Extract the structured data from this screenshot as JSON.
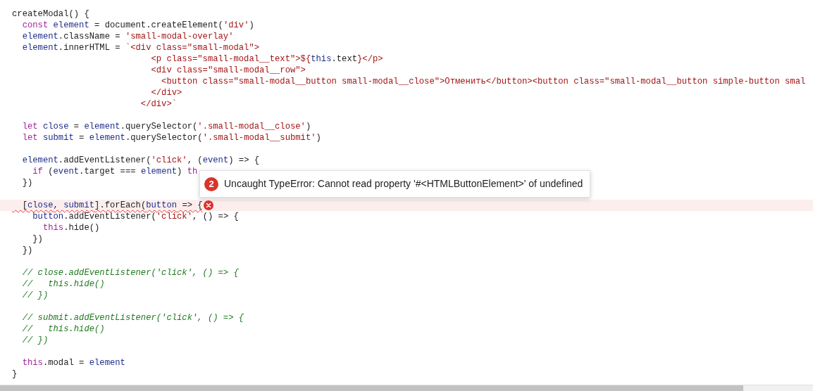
{
  "editor": {
    "lines": [
      {
        "kind": "code",
        "error": false,
        "tokens": [
          {
            "kind": "plain",
            "text": "createModal() {"
          }
        ]
      },
      {
        "kind": "code",
        "error": false,
        "tokens": [
          {
            "kind": "keyword",
            "text": "  const"
          },
          {
            "kind": "identifier",
            "text": " element"
          },
          {
            "kind": "plain",
            "text": " = document.createElement("
          },
          {
            "kind": "string",
            "text": "'div'"
          },
          {
            "kind": "plain",
            "text": ")"
          }
        ]
      },
      {
        "kind": "code",
        "error": false,
        "tokens": [
          {
            "kind": "identifier",
            "text": "  element"
          },
          {
            "kind": "plain",
            "text": ".className = "
          },
          {
            "kind": "string",
            "text": "'small-modal-overlay'"
          }
        ]
      },
      {
        "kind": "code",
        "error": false,
        "tokens": [
          {
            "kind": "identifier",
            "text": "  element"
          },
          {
            "kind": "plain",
            "text": ".innerHTML = "
          },
          {
            "kind": "string",
            "text": "`<div class=\"small-modal\">"
          }
        ]
      },
      {
        "kind": "code",
        "error": false,
        "tokens": [
          {
            "kind": "string",
            "text": "                           <p class=\"small-modal__text\">${"
          },
          {
            "kind": "identifier",
            "text": "this"
          },
          {
            "kind": "plain",
            "text": ".text"
          },
          {
            "kind": "string",
            "text": "}</p>"
          }
        ]
      },
      {
        "kind": "code",
        "error": false,
        "tokens": [
          {
            "kind": "string",
            "text": "                           <div class=\"small-modal__row\">"
          }
        ]
      },
      {
        "kind": "code",
        "error": false,
        "tokens": [
          {
            "kind": "string",
            "text": "                             <button class=\"small-modal__button small-modal__close\">Отменить</button><button class=\"small-modal__button simple-button smal"
          }
        ]
      },
      {
        "kind": "code",
        "error": false,
        "tokens": [
          {
            "kind": "string",
            "text": "                           </div>"
          }
        ]
      },
      {
        "kind": "code",
        "error": false,
        "tokens": [
          {
            "kind": "string",
            "text": "                         </div>`"
          }
        ]
      },
      {
        "kind": "blank"
      },
      {
        "kind": "code",
        "error": false,
        "tokens": [
          {
            "kind": "keyword",
            "text": "  let"
          },
          {
            "kind": "identifier",
            "text": " close"
          },
          {
            "kind": "plain",
            "text": " = "
          },
          {
            "kind": "identifier",
            "text": "element"
          },
          {
            "kind": "plain",
            "text": ".querySelector("
          },
          {
            "kind": "string",
            "text": "'.small-modal__close'"
          },
          {
            "kind": "plain",
            "text": ")"
          }
        ]
      },
      {
        "kind": "code",
        "error": false,
        "tokens": [
          {
            "kind": "keyword",
            "text": "  let"
          },
          {
            "kind": "identifier",
            "text": " submit"
          },
          {
            "kind": "plain",
            "text": " = "
          },
          {
            "kind": "identifier",
            "text": "element"
          },
          {
            "kind": "plain",
            "text": ".querySelector("
          },
          {
            "kind": "string",
            "text": "'.small-modal__submit'"
          },
          {
            "kind": "plain",
            "text": ")"
          }
        ]
      },
      {
        "kind": "blank"
      },
      {
        "kind": "code",
        "error": false,
        "tokens": [
          {
            "kind": "identifier",
            "text": "  element"
          },
          {
            "kind": "plain",
            "text": ".addEventListener("
          },
          {
            "kind": "string",
            "text": "'click'"
          },
          {
            "kind": "plain",
            "text": ", ("
          },
          {
            "kind": "identifier",
            "text": "event"
          },
          {
            "kind": "plain",
            "text": ") => {"
          }
        ]
      },
      {
        "kind": "code",
        "error": false,
        "tokens": [
          {
            "kind": "keyword",
            "text": "    if"
          },
          {
            "kind": "plain",
            "text": " ("
          },
          {
            "kind": "identifier",
            "text": "event"
          },
          {
            "kind": "plain",
            "text": ".target === "
          },
          {
            "kind": "identifier",
            "text": "element"
          },
          {
            "kind": "plain",
            "text": ") "
          },
          {
            "kind": "keyword",
            "text": "th"
          }
        ]
      },
      {
        "kind": "code",
        "error": false,
        "tokens": [
          {
            "kind": "plain",
            "text": "  })"
          }
        ]
      },
      {
        "kind": "blank"
      },
      {
        "kind": "code",
        "error": true,
        "tokens": [
          {
            "kind": "plain",
            "text": "  ["
          },
          {
            "kind": "identifier",
            "text": "close"
          },
          {
            "kind": "plain",
            "text": ", "
          },
          {
            "kind": "identifier",
            "text": "submit"
          },
          {
            "kind": "plain",
            "text": "].forEach("
          },
          {
            "kind": "identifier",
            "text": "button"
          },
          {
            "kind": "plain",
            "text": " => {"
          }
        ]
      },
      {
        "kind": "code",
        "error": false,
        "tokens": [
          {
            "kind": "identifier",
            "text": "    button"
          },
          {
            "kind": "plain",
            "text": ".addEventListener("
          },
          {
            "kind": "string",
            "text": "'click'"
          },
          {
            "kind": "plain",
            "text": ", () => {"
          }
        ]
      },
      {
        "kind": "code",
        "error": false,
        "tokens": [
          {
            "kind": "keyword",
            "text": "      this"
          },
          {
            "kind": "plain",
            "text": ".hide()"
          }
        ]
      },
      {
        "kind": "code",
        "error": false,
        "tokens": [
          {
            "kind": "plain",
            "text": "    })"
          }
        ]
      },
      {
        "kind": "code",
        "error": false,
        "tokens": [
          {
            "kind": "plain",
            "text": "  })"
          }
        ]
      },
      {
        "kind": "blank"
      },
      {
        "kind": "code",
        "error": false,
        "tokens": [
          {
            "kind": "comment",
            "text": "  // close.addEventListener('click', () => {"
          }
        ]
      },
      {
        "kind": "code",
        "error": false,
        "tokens": [
          {
            "kind": "comment",
            "text": "  //   this.hide()"
          }
        ]
      },
      {
        "kind": "code",
        "error": false,
        "tokens": [
          {
            "kind": "comment",
            "text": "  // })"
          }
        ]
      },
      {
        "kind": "blank"
      },
      {
        "kind": "code",
        "error": false,
        "tokens": [
          {
            "kind": "comment",
            "text": "  // submit.addEventListener('click', () => {"
          }
        ]
      },
      {
        "kind": "code",
        "error": false,
        "tokens": [
          {
            "kind": "comment",
            "text": "  //   this.hide()"
          }
        ]
      },
      {
        "kind": "code",
        "error": false,
        "tokens": [
          {
            "kind": "comment",
            "text": "  // })"
          }
        ]
      },
      {
        "kind": "blank"
      },
      {
        "kind": "code",
        "error": false,
        "tokens": [
          {
            "kind": "keyword",
            "text": "  this"
          },
          {
            "kind": "plain",
            "text": ".modal = "
          },
          {
            "kind": "identifier",
            "text": "element"
          }
        ]
      },
      {
        "kind": "code",
        "error": false,
        "tokens": [
          {
            "kind": "plain",
            "text": "}"
          }
        ]
      }
    ]
  },
  "error_tooltip": {
    "count": "2",
    "message": "Uncaught TypeError: Cannot read property '#<HTMLButtonElement>' of undefined"
  }
}
